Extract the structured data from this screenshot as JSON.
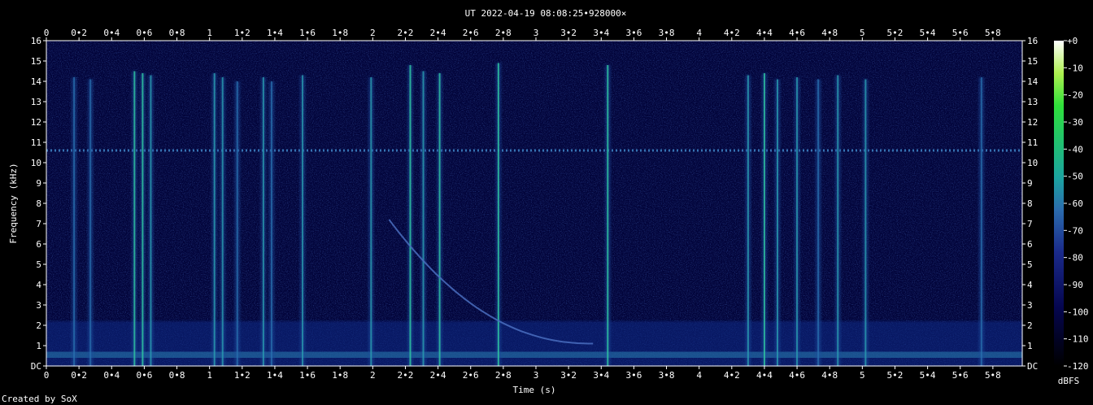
{
  "chart_data": {
    "type": "heatmap",
    "title": "UT 2022-04-19 08:08:25•928000×",
    "xlabel": "Time (s)",
    "ylabel": "Frequency (kHz)",
    "xlim": [
      0,
      5.98
    ],
    "ylim": [
      0,
      16
    ],
    "x_ticks": [
      "0",
      "0•2",
      "0•4",
      "0•6",
      "0•8",
      "1",
      "1•2",
      "1•4",
      "1•6",
      "1•8",
      "2",
      "2•2",
      "2•4",
      "2•6",
      "2•8",
      "3",
      "3•2",
      "3•4",
      "3•6",
      "3•8",
      "4",
      "4•2",
      "4•4",
      "4•6",
      "4•8",
      "5",
      "5•2",
      "5•4",
      "5•6",
      "5•8"
    ],
    "y_ticks": [
      "DC",
      "1",
      "2",
      "3",
      "4",
      "5",
      "6",
      "7",
      "8",
      "9",
      "10",
      "11",
      "12",
      "13",
      "14",
      "15",
      "16"
    ],
    "colorbar": {
      "label": "dBFS",
      "ticks": [
        "+0",
        "-10",
        "-20",
        "-30",
        "-40",
        "-50",
        "-60",
        "-70",
        "-80",
        "-90",
        "-100",
        "-110",
        "-120"
      ],
      "range": [
        -120,
        0
      ]
    },
    "steady_tone_khz": 10.6,
    "descending_tone": {
      "start_s": 2.1,
      "start_khz": 7.2,
      "end_s": 3.35,
      "end_khz": 1.1
    },
    "bursts": [
      {
        "t": 0.17,
        "top_khz": 14.2,
        "level": 0.35
      },
      {
        "t": 0.27,
        "top_khz": 14.1,
        "level": 0.3
      },
      {
        "t": 0.54,
        "top_khz": 14.5,
        "level": 0.55
      },
      {
        "t": 0.59,
        "top_khz": 14.4,
        "level": 0.6
      },
      {
        "t": 0.64,
        "top_khz": 14.3,
        "level": 0.45
      },
      {
        "t": 1.03,
        "top_khz": 14.4,
        "level": 0.5
      },
      {
        "t": 1.08,
        "top_khz": 14.2,
        "level": 0.45
      },
      {
        "t": 1.17,
        "top_khz": 14.0,
        "level": 0.35
      },
      {
        "t": 1.33,
        "top_khz": 14.2,
        "level": 0.45
      },
      {
        "t": 1.38,
        "top_khz": 14.0,
        "level": 0.35
      },
      {
        "t": 1.57,
        "top_khz": 14.3,
        "level": 0.45
      },
      {
        "t": 1.99,
        "top_khz": 14.2,
        "level": 0.5
      },
      {
        "t": 2.23,
        "top_khz": 14.8,
        "level": 0.6
      },
      {
        "t": 2.31,
        "top_khz": 14.5,
        "level": 0.5
      },
      {
        "t": 2.41,
        "top_khz": 14.4,
        "level": 0.55
      },
      {
        "t": 2.77,
        "top_khz": 14.9,
        "level": 0.6
      },
      {
        "t": 3.44,
        "top_khz": 14.8,
        "level": 0.6
      },
      {
        "t": 4.3,
        "top_khz": 14.3,
        "level": 0.5
      },
      {
        "t": 4.4,
        "top_khz": 14.4,
        "level": 0.55
      },
      {
        "t": 4.48,
        "top_khz": 14.1,
        "level": 0.45
      },
      {
        "t": 4.6,
        "top_khz": 14.2,
        "level": 0.45
      },
      {
        "t": 4.73,
        "top_khz": 14.1,
        "level": 0.4
      },
      {
        "t": 4.85,
        "top_khz": 14.3,
        "level": 0.5
      },
      {
        "t": 5.02,
        "top_khz": 14.1,
        "level": 0.45
      },
      {
        "t": 5.73,
        "top_khz": 14.2,
        "level": 0.35
      }
    ],
    "grid": false
  },
  "footer": {
    "credit": "Created by SoX"
  },
  "colors": {
    "background": "#000000",
    "text": "#ffffff"
  }
}
